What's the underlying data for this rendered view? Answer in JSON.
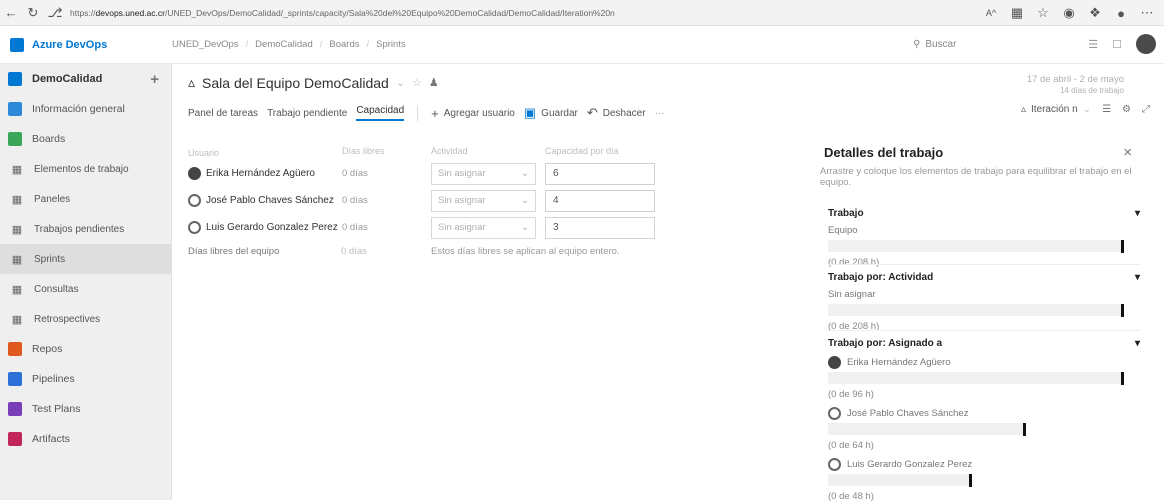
{
  "browser": {
    "url_prefix": "https://",
    "url_host": "devops.uned.ac.cr",
    "url_path": "/UNED_DevOps/DemoCalidad/_sprints/capacity/Sala%20del%20Equipo%20DemoCalidad/DemoCalidad/Iteration%20n",
    "zoom": "A^"
  },
  "appbar": {
    "brand": "Azure DevOps",
    "breadcrumbs": [
      "UNED_DevOps",
      "DemoCalidad",
      "Boards",
      "Sprints"
    ],
    "search_placeholder": "Buscar"
  },
  "sidebar": {
    "project": "DemoCalidad",
    "add_symbol": "+",
    "items": [
      {
        "label": "Información general",
        "icon": "overview-icon",
        "color": "#2e8ad8"
      },
      {
        "label": "Boards",
        "icon": "boards-icon",
        "color": "#3aa65a"
      },
      {
        "label": "Elementos de trabajo",
        "icon": "work-items-icon",
        "sub": true
      },
      {
        "label": "Paneles",
        "icon": "panels-icon",
        "sub": true
      },
      {
        "label": "Trabajos pendientes",
        "icon": "backlogs-icon",
        "sub": true
      },
      {
        "label": "Sprints",
        "icon": "sprints-icon",
        "sub": true,
        "active": true
      },
      {
        "label": "Consultas",
        "icon": "queries-icon",
        "sub": true
      },
      {
        "label": "Retrospectives",
        "icon": "retrospectives-icon",
        "sub": true
      },
      {
        "label": "Repos",
        "icon": "repos-icon",
        "color": "#e05a1f"
      },
      {
        "label": "Pipelines",
        "icon": "pipelines-icon",
        "color": "#2c6fd6"
      },
      {
        "label": "Test Plans",
        "icon": "test-plans-icon",
        "color": "#7a3db8"
      },
      {
        "label": "Artifacts",
        "icon": "artifacts-icon",
        "color": "#c2255c"
      }
    ]
  },
  "header": {
    "team_name": "Sala del Equipo DemoCalidad",
    "date_range": "17 de abril - 2 de mayo",
    "work_days": "14 días de trabajo"
  },
  "tabs": [
    "Panel de tareas",
    "Trabajo pendiente",
    "Capacidad"
  ],
  "active_tab": "Capacidad",
  "toolbar": {
    "add_user": "Agregar usuario",
    "save": "Guardar",
    "undo": "Deshacer",
    "more": "···",
    "iteration": "Iteración n"
  },
  "capacity": {
    "columns": [
      "Usuario",
      "Días libres",
      "Actividad",
      "Capacidad por día"
    ],
    "rows": [
      {
        "user": "Erika Hernández Agüero",
        "avatar": "photo",
        "days_off": "0 días",
        "activity": "Sin asignar",
        "capacity": "6"
      },
      {
        "user": "José Pablo Chaves Sánchez",
        "avatar": "generic",
        "days_off": "0 días",
        "activity": "Sin asignar",
        "capacity": "4"
      },
      {
        "user": "Luis Gerardo Gonzalez Perez",
        "avatar": "generic",
        "days_off": "0 días",
        "activity": "Sin asignar",
        "capacity": "3"
      }
    ],
    "team_days_label": "Días libres del equipo",
    "team_days_value": "0 días",
    "team_days_note": "Estos días libres se aplican al equipo entero."
  },
  "details": {
    "title": "Detalles del trabajo",
    "description": "Arrastre y coloque los elementos de trabajo para equilibrar el trabajo en el equipo.",
    "work": {
      "title": "Trabajo",
      "label": "Equipo",
      "hours": "(0 de 208 h)",
      "fill_fraction": 0
    },
    "by_activity": {
      "title": "Trabajo por: Actividad",
      "label": "Sin asignar",
      "hours": "(0 de 208 h)",
      "fill_fraction": 0
    },
    "by_assigned": {
      "title": "Trabajo por: Asignado a",
      "users": [
        {
          "name": "Erika Hernández Agüero",
          "hours": "(0 de 96 h)"
        },
        {
          "name": "José Pablo Chaves Sánchez",
          "hours": "(0 de 64 h)"
        },
        {
          "name": "Luis Gerardo Gonzalez Perez",
          "hours": "(0 de 48 h)"
        }
      ]
    }
  }
}
